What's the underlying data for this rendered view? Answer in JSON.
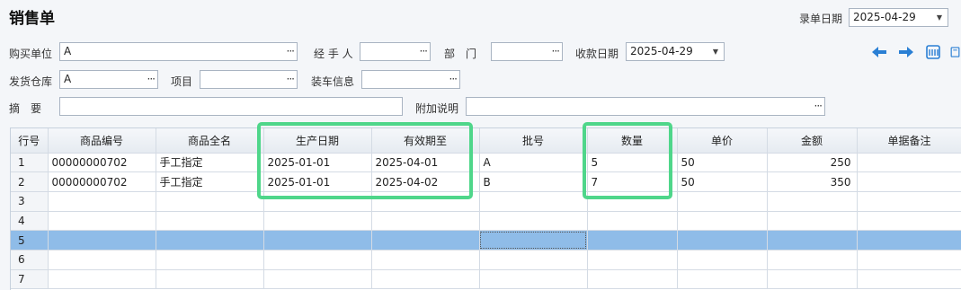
{
  "title": "销售单",
  "entry_date": {
    "label": "录单日期",
    "value": "2025-04-29"
  },
  "form": {
    "buyer": {
      "label": "购买单位",
      "value": "A"
    },
    "handler": {
      "label": "经 手 人",
      "value": ""
    },
    "dept": {
      "label": "部　门",
      "value": ""
    },
    "receipt_date": {
      "label": "收款日期",
      "value": "2025-04-29"
    },
    "warehouse": {
      "label": "发货仓库",
      "value": "A"
    },
    "project": {
      "label": "项目",
      "value": ""
    },
    "loading": {
      "label": "装车信息",
      "value": ""
    },
    "summary": {
      "label": "摘　要",
      "value": ""
    },
    "notes": {
      "label": "附加说明",
      "value": ""
    }
  },
  "ellipsis": "···",
  "dropdown_glyph": "▼",
  "toolbar": [
    "arrow-left-icon",
    "arrow-right-icon",
    "calculator-icon",
    "copy-icon"
  ],
  "colors": {
    "highlight": "#4fd68a",
    "selected_row": "#8fbce8",
    "accent_blue": "#2a7fd4"
  },
  "table": {
    "columns": [
      "行号",
      "商品编号",
      "商品全名",
      "生产日期",
      "有效期至",
      "批号",
      "数量",
      "单价",
      "金额",
      "单据备注"
    ],
    "rows": [
      {
        "no": "1",
        "code": "00000000702",
        "name": "手工指定",
        "prod": "2025-01-01",
        "exp": "2025-04-01",
        "batch": "A",
        "qty": "5",
        "price": "50",
        "amount": "250",
        "remark": ""
      },
      {
        "no": "2",
        "code": "00000000702",
        "name": "手工指定",
        "prod": "2025-01-01",
        "exp": "2025-04-02",
        "batch": "B",
        "qty": "7",
        "price": "50",
        "amount": "350",
        "remark": ""
      },
      {
        "no": "3"
      },
      {
        "no": "4"
      },
      {
        "no": "5"
      },
      {
        "no": "6"
      },
      {
        "no": "7"
      }
    ]
  }
}
